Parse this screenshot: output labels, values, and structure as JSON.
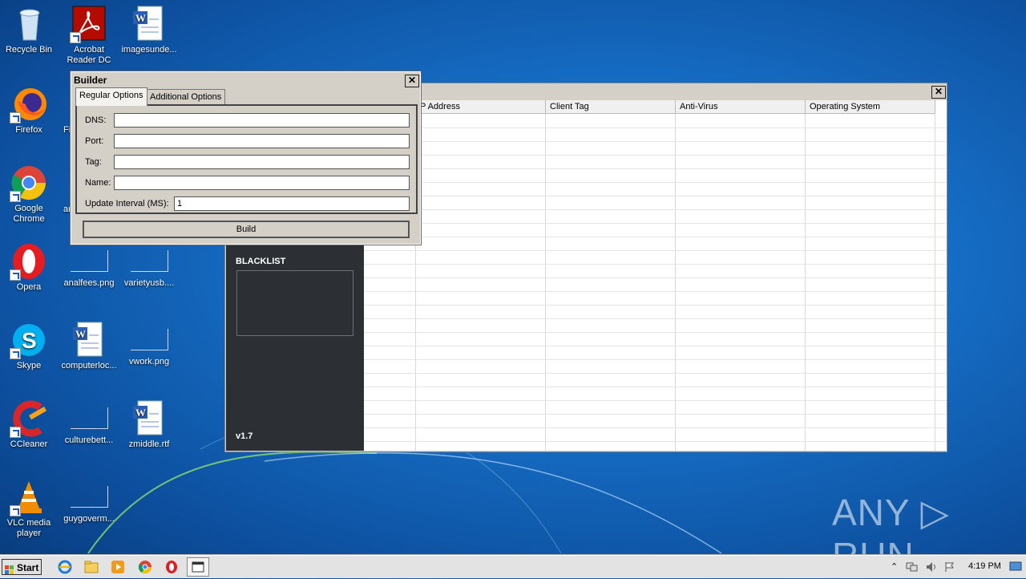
{
  "desktop": {
    "icons": [
      {
        "label": "Recycle Bin"
      },
      {
        "label": "Acrobat Reader DC"
      },
      {
        "label": "imagesunde..."
      },
      {
        "label": "Firefox"
      },
      {
        "label": "Fi"
      },
      {
        "label": "Google Chrome"
      },
      {
        "label": "ar"
      },
      {
        "label": "Opera"
      },
      {
        "label": "analfees.png"
      },
      {
        "label": "varietyusb...."
      },
      {
        "label": "Skype"
      },
      {
        "label": "computerloc..."
      },
      {
        "label": "vwork.png"
      },
      {
        "label": "CCleaner"
      },
      {
        "label": "culturebett..."
      },
      {
        "label": "zmiddle.rtf"
      },
      {
        "label": "VLC media player"
      },
      {
        "label": "guygoverm..."
      }
    ]
  },
  "main_window": {
    "columns": [
      "P Address",
      "Client Tag",
      "Anti-Virus",
      "Operating System"
    ],
    "blacklist_label": "BLACKLIST",
    "version": "v1.7",
    "close_glyph": "✕"
  },
  "builder": {
    "title": "Builder",
    "close_glyph": "✕",
    "tabs": [
      "Regular Options",
      "Additional Options"
    ],
    "fields": {
      "dns_label": "DNS:",
      "dns_value": "",
      "port_label": "Port:",
      "port_value": "",
      "tag_label": "Tag:",
      "tag_value": "",
      "name_label": "Name:",
      "name_value": "",
      "interval_label": "Update Interval (MS):",
      "interval_value": "1"
    },
    "build_label": "Build"
  },
  "taskbar": {
    "start_label": "Start",
    "clock": "4:19 PM"
  },
  "watermark": "ANY ▷ RUN"
}
